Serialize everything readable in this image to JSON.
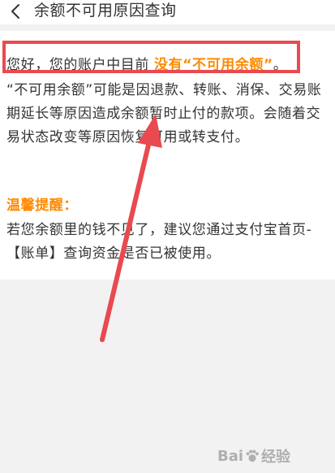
{
  "header": {
    "back_icon": "chevron-left-icon",
    "title": "余额不可用原因查询"
  },
  "content": {
    "line1_prefix": "您好，您的账户中目前 ",
    "line1_highlight": "没有“不可用余额”",
    "line1_suffix": "。",
    "explanation": "“不可用余额”可能是因退款、转账、消保、交易账期延长等原因造成余额暂时止付的款项。会随着交易状态改变等原因恢复可用或转支付。",
    "tip_title": "温馨提醒：",
    "tip_text": "若您余额里的钱不见了，建议您通过支付宝首页-【账单】查询资金是否已被使用。"
  },
  "annotation": {
    "color": "#e84a4f"
  },
  "colors": {
    "highlight": "#ff8a00",
    "text": "#333333",
    "background": "#f2f2f2"
  },
  "watermark": {
    "text_left": "Bai",
    "text_right": "经验"
  }
}
